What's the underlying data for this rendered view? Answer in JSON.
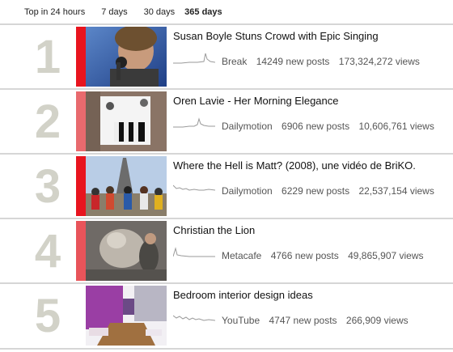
{
  "tabs": [
    {
      "label": "Top in 24 hours"
    },
    {
      "label": "7 days"
    },
    {
      "label": "30 days"
    },
    {
      "label": "365 days",
      "active": true
    }
  ],
  "items": [
    {
      "rank": "1",
      "title": "Susan Boyle Stuns Crowd with Epic Singing",
      "source": "Break",
      "posts": "14249 new posts",
      "views": "173,324,272 views",
      "heat_color": "#e8141e"
    },
    {
      "rank": "2",
      "title": "Oren Lavie - Her Morning Elegance",
      "source": "Dailymotion",
      "posts": "6906 new posts",
      "views": "10,606,761 views",
      "heat_color": "#e86a6e"
    },
    {
      "rank": "3",
      "title": "Where the Hell is Matt? (2008), une vidéo de BriKO.",
      "source": "Dailymotion",
      "posts": "6229 new posts",
      "views": "22,537,154 views",
      "heat_color": "#e8141e"
    },
    {
      "rank": "4",
      "title": "Christian the Lion",
      "source": "Metacafe",
      "posts": "4766 new posts",
      "views": "49,865,907 views",
      "heat_color": "#e8545a"
    },
    {
      "rank": "5",
      "title": "Bedroom interior design ideas",
      "source": "YouTube",
      "posts": "4747 new posts",
      "views": "266,909 views",
      "heat_color": "#ffffff"
    }
  ]
}
